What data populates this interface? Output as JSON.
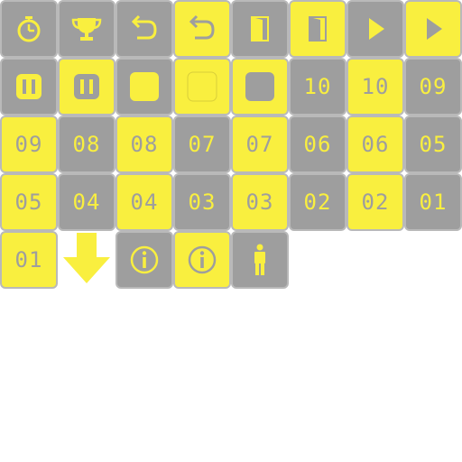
{
  "colors": {
    "gray": "#9e9e9e",
    "yellow": "#f9ef3f",
    "border": "#b9b9b9"
  },
  "tiles": [
    {
      "icon": "stopwatch-icon",
      "theme": "gray"
    },
    {
      "icon": "trophy-icon",
      "theme": "gray"
    },
    {
      "icon": "undo-icon",
      "theme": "gray"
    },
    {
      "icon": "undo-icon",
      "theme": "yellow"
    },
    {
      "icon": "door-icon",
      "theme": "gray"
    },
    {
      "icon": "door-icon",
      "theme": "yellow"
    },
    {
      "icon": "play-icon",
      "theme": "gray"
    },
    {
      "icon": "play-icon",
      "theme": "yellow"
    },
    {
      "icon": "pause-icon",
      "theme": "gray"
    },
    {
      "icon": "pause-icon",
      "theme": "yellow"
    },
    {
      "icon": "stop-icon",
      "theme": "gray"
    },
    {
      "icon": "stop-icon",
      "theme": "yellow"
    },
    {
      "icon": "stop-icon",
      "theme": "yellow-gray"
    },
    {
      "label": "10",
      "theme": "gray"
    },
    {
      "label": "10",
      "theme": "yellow"
    },
    {
      "label": "09",
      "theme": "gray"
    },
    {
      "label": "09",
      "theme": "yellow"
    },
    {
      "label": "08",
      "theme": "gray"
    },
    {
      "label": "08",
      "theme": "yellow"
    },
    {
      "label": "07",
      "theme": "gray"
    },
    {
      "label": "07",
      "theme": "yellow"
    },
    {
      "label": "06",
      "theme": "gray"
    },
    {
      "label": "06",
      "theme": "yellow"
    },
    {
      "label": "05",
      "theme": "gray"
    },
    {
      "label": "05",
      "theme": "yellow"
    },
    {
      "label": "04",
      "theme": "gray"
    },
    {
      "label": "04",
      "theme": "yellow"
    },
    {
      "label": "03",
      "theme": "gray"
    },
    {
      "label": "03",
      "theme": "yellow"
    },
    {
      "label": "02",
      "theme": "gray"
    },
    {
      "label": "02",
      "theme": "yellow"
    },
    {
      "label": "01",
      "theme": "gray"
    },
    {
      "label": "01",
      "theme": "yellow"
    },
    {
      "icon": "down-arrow-icon",
      "theme": "plain"
    },
    {
      "icon": "info-icon",
      "theme": "gray"
    },
    {
      "icon": "info-icon",
      "theme": "yellow"
    },
    {
      "icon": "person-icon",
      "theme": "gray"
    }
  ]
}
